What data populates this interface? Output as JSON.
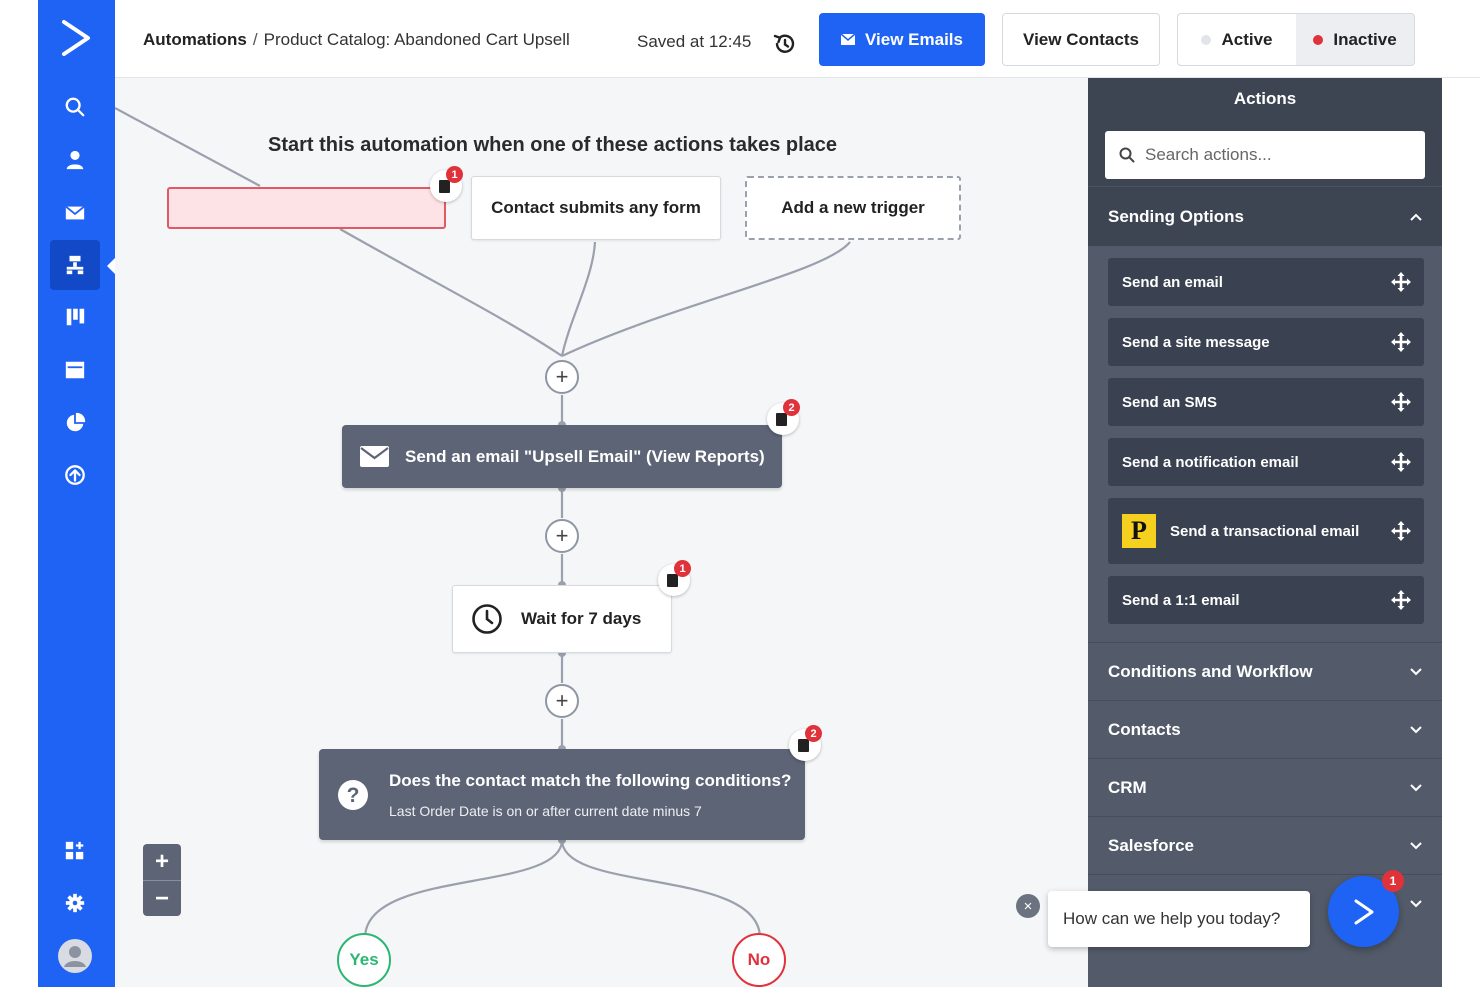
{
  "header": {
    "breadcrumb_root": "Automations",
    "breadcrumb_separator": "/",
    "breadcrumb_current": "Product Catalog: Abandoned Cart Upsell",
    "saved_text": "Saved at 12:45",
    "view_emails_label": "View Emails",
    "view_contacts_label": "View Contacts",
    "status_active_label": "Active",
    "status_inactive_label": "Inactive",
    "selected_status": "Inactive"
  },
  "sidebar": {
    "items": [
      {
        "icon": "search-icon"
      },
      {
        "icon": "contacts-icon"
      },
      {
        "icon": "campaigns-icon"
      },
      {
        "icon": "automations-icon",
        "active": true
      },
      {
        "icon": "deals-icon"
      },
      {
        "icon": "site-icon"
      },
      {
        "icon": "reports-icon"
      },
      {
        "icon": "upgrade-icon"
      },
      {
        "icon": "apps-icon"
      },
      {
        "icon": "settings-icon"
      },
      {
        "icon": "avatar-icon"
      }
    ]
  },
  "canvas": {
    "headline": "Start this automation when one of these actions takes place",
    "triggers": [
      {
        "label": "",
        "state": "error",
        "badge": "1"
      },
      {
        "label": "Contact submits any form"
      },
      {
        "label": "Add a new trigger",
        "style": "dashed"
      }
    ],
    "steps": {
      "send_email": {
        "label": "Send an email \"Upsell Email\" (View Reports)",
        "badge": "2"
      },
      "wait": {
        "label": "Wait for 7 days",
        "badge": "1"
      },
      "condition": {
        "title": "Does the contact match the following conditions?",
        "detail": "Last Order Date is on or after current date minus 7",
        "badge": "2"
      }
    },
    "branches": {
      "yes": "Yes",
      "no": "No"
    },
    "zoom_in": "+",
    "zoom_out": "−"
  },
  "panel": {
    "title": "Actions",
    "search_placeholder": "Search actions...",
    "sending_options_label": "Sending Options",
    "sending_actions": [
      "Send an email",
      "Send a site message",
      "Send an SMS",
      "Send a notification email",
      "Send a transactional email",
      "Send a 1:1 email"
    ],
    "transactional_badge": "P",
    "collapsed_sections": [
      "Conditions and Workflow",
      "Contacts",
      "CRM",
      "Salesforce"
    ]
  },
  "chat": {
    "prompt": "How can we help you today?",
    "count": "1",
    "close": "×"
  },
  "colors": {
    "brand_blue": "#1f63f5",
    "panel_dark": "#3d4452",
    "node_dark": "#5c6475",
    "yes_green": "#2bb673",
    "no_red": "#e0323b"
  }
}
